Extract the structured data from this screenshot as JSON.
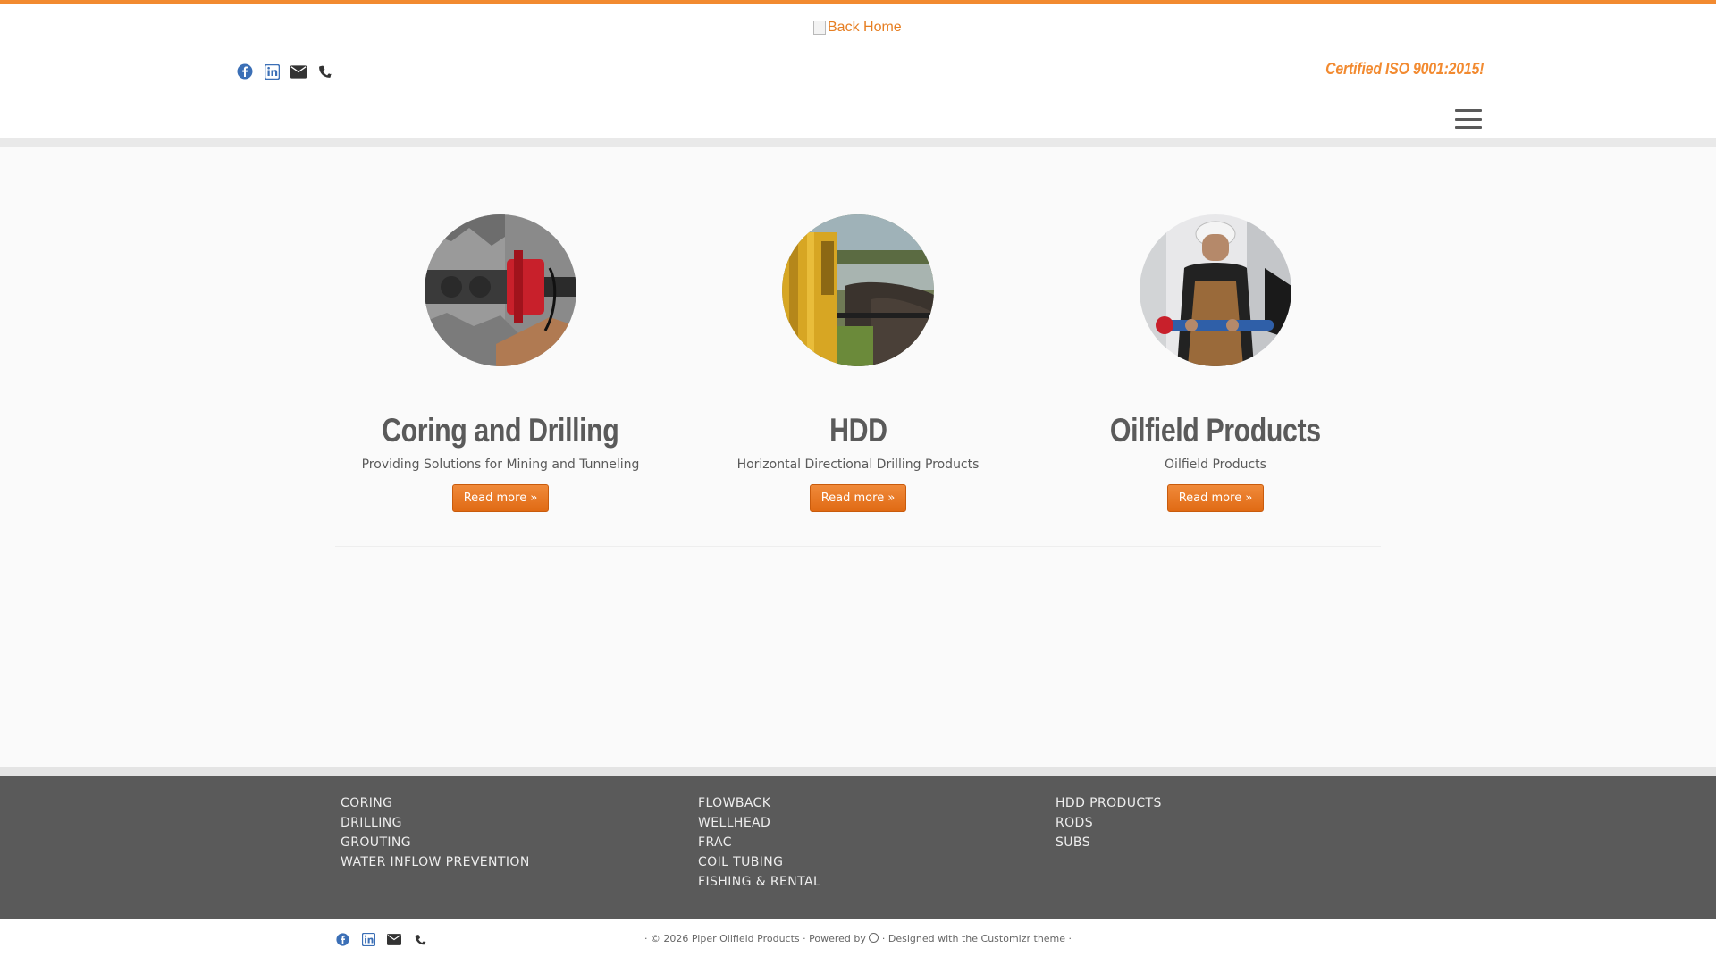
{
  "header": {
    "logo_alt": "Back Home",
    "tagline": "Certified ISO 9001:2015!",
    "social_icons": [
      "facebook-icon",
      "linkedin-icon",
      "envelope-icon",
      "phone-icon"
    ]
  },
  "colors": {
    "accent": "#f28a30",
    "button": "#e67e22",
    "text": "#5a5a5a",
    "footer_bg": "#5a5a5a"
  },
  "features": [
    {
      "title": "Coring and Drilling",
      "description": "Providing Solutions for Mining and Tunneling",
      "button": "Read more »",
      "image": "drilling-equipment-photo"
    },
    {
      "title": "HDD",
      "description": "Horizontal Directional Drilling Products",
      "button": "Read more »",
      "image": "hdd-rig-photo"
    },
    {
      "title": "Oilfield Products",
      "description": "Oilfield Products",
      "button": "Read more »",
      "image": "oilfield-worker-photo"
    }
  ],
  "footer": {
    "col1": [
      "CORING",
      "DRILLING",
      "GROUTING",
      "WATER INFLOW PREVENTION"
    ],
    "col2": [
      "FLOWBACK",
      "WELLHEAD",
      "FRAC",
      "COIL TUBING",
      "FISHING & RENTAL"
    ],
    "col3": [
      "HDD PRODUCTS",
      "RODS",
      "SUBS"
    ]
  },
  "colophon": {
    "copyright": "· © 2026 Piper Oilfield Products ·",
    "powered_by": "Powered by",
    "designed_with": "· Designed with the",
    "theme_link": "Customizr theme",
    "trailing": "·"
  }
}
